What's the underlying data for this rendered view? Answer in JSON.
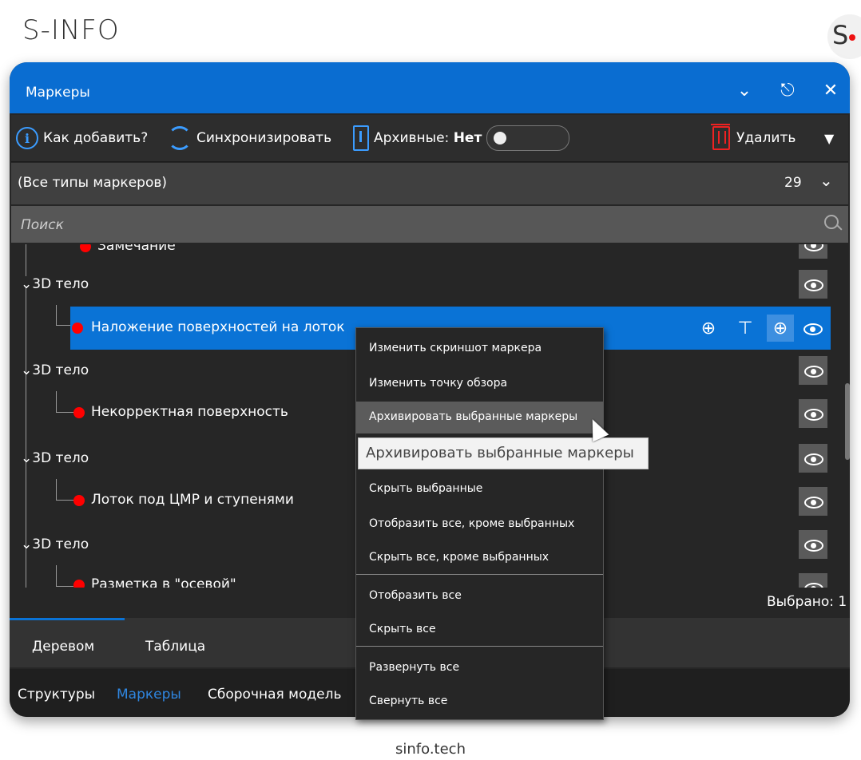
{
  "brand": {
    "name": "S-INFO",
    "logo_letter": "S",
    "footer": "sinfo.tech"
  },
  "panel": {
    "title": "Маркеры",
    "controls": {
      "collapse_icon": "chevron-down-icon",
      "pin_icon": "pin-icon",
      "close_icon": "close-icon"
    }
  },
  "toolbar": {
    "how_to_add": "Как добавить?",
    "sync": "Синхронизировать",
    "archived_label": "Архивные:",
    "archived_value": "Нет",
    "archived_toggle_on": false,
    "delete": "Удалить"
  },
  "filter": {
    "label": "(Все типы маркеров)",
    "count": "29"
  },
  "search": {
    "placeholder": "Поиск"
  },
  "tree": {
    "partial_top": "Замечание",
    "groups": [
      {
        "label": "3D тело",
        "child": "Наложение поверхностей на лоток",
        "selected": true
      },
      {
        "label": "3D тело",
        "child": "Некорректная поверхность",
        "selected": false
      },
      {
        "label": "3D тело",
        "child": "Лоток под ЦМР и ступенями",
        "selected": false
      },
      {
        "label": "3D тело",
        "child": "Разметка в \"осевой\"",
        "selected": false
      }
    ],
    "marker_color": "#ff0000",
    "selection_color": "#0a73d6"
  },
  "selected_count": "Выбрано: 1",
  "view_tabs": [
    "Деревом",
    "Таблица"
  ],
  "bottom_tabs": [
    "Структуры",
    "Маркеры",
    "Сборочная модель"
  ],
  "context_menu": {
    "items": [
      "Изменить скриншот маркера",
      "Изменить точку обзора",
      "Архивировать выбранные маркеры",
      "Скрыть выбранные",
      "Отобразить все, кроме выбранных",
      "Скрыть все, кроме выбранных",
      "Отобразить все",
      "Скрыть все",
      "Развернуть все",
      "Свернуть все"
    ],
    "highlighted": "Архивировать выбранные маркеры"
  },
  "tooltip": "Архивировать выбранные маркеры",
  "colors": {
    "accent": "#0a6dd1",
    "background": "#262626",
    "danger": "#ee2222"
  }
}
